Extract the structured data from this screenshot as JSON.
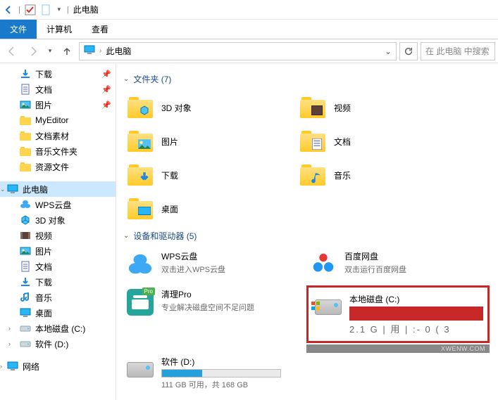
{
  "title": "此电脑",
  "ribbon": {
    "file": "文件",
    "computer": "计算机",
    "view": "查看"
  },
  "address": {
    "location": "此电脑"
  },
  "search": {
    "placeholder": "在 此电脑 中搜索"
  },
  "sidebar": {
    "quick": [
      {
        "label": "下载",
        "pin": true,
        "icon": "download"
      },
      {
        "label": "文档",
        "pin": true,
        "icon": "doc"
      },
      {
        "label": "图片",
        "pin": true,
        "icon": "pic"
      },
      {
        "label": "MyEditor",
        "pin": false,
        "icon": "folder"
      },
      {
        "label": "文档素材",
        "pin": false,
        "icon": "folder"
      },
      {
        "label": "音乐文件夹",
        "pin": false,
        "icon": "folder"
      },
      {
        "label": "资源文件",
        "pin": false,
        "icon": "folder"
      }
    ],
    "thispc": {
      "label": "此电脑"
    },
    "pc_children": [
      {
        "label": "WPS云盘",
        "icon": "wps"
      },
      {
        "label": "3D 对象",
        "icon": "3d"
      },
      {
        "label": "视频",
        "icon": "video"
      },
      {
        "label": "图片",
        "icon": "pic"
      },
      {
        "label": "文档",
        "icon": "doc"
      },
      {
        "label": "下载",
        "icon": "download"
      },
      {
        "label": "音乐",
        "icon": "music"
      },
      {
        "label": "桌面",
        "icon": "desktop"
      },
      {
        "label": "本地磁盘 (C:)",
        "icon": "drive",
        "chev": true
      },
      {
        "label": "软件 (D:)",
        "icon": "drive",
        "chev": true
      }
    ],
    "network": {
      "label": "网络"
    }
  },
  "sections": {
    "folders": {
      "title": "文件夹 (7)",
      "items": [
        {
          "label": "3D 对象",
          "icon": "3d"
        },
        {
          "label": "视频",
          "icon": "video"
        },
        {
          "label": "图片",
          "icon": "pic"
        },
        {
          "label": "文档",
          "icon": "doc"
        },
        {
          "label": "下载",
          "icon": "download"
        },
        {
          "label": "音乐",
          "icon": "music"
        },
        {
          "label": "桌面",
          "icon": "desktop"
        }
      ]
    },
    "devices": {
      "title": "设备和驱动器 (5)",
      "items": [
        {
          "label": "WPS云盘",
          "sub": "双击进入WPS云盘",
          "icon": "wps-big"
        },
        {
          "label": "百度网盘",
          "sub": "双击运行百度网盘",
          "icon": "baidu"
        },
        {
          "label": "清理Pro",
          "sub": "专业解决磁盘空间不足问题",
          "icon": "cleaner",
          "badge": "Pro"
        },
        {
          "label": "本地磁盘 (C:)",
          "sub_obscured": "2.1  G  |  用  | :- 0  ( 3",
          "icon": "drive-c",
          "highlight": true
        },
        {
          "label": "软件 (D:)",
          "sub": "111 GB 可用，共 168 GB",
          "icon": "drive-d",
          "fill_pct": 34
        }
      ]
    }
  },
  "watermark": "XWENW.COM"
}
